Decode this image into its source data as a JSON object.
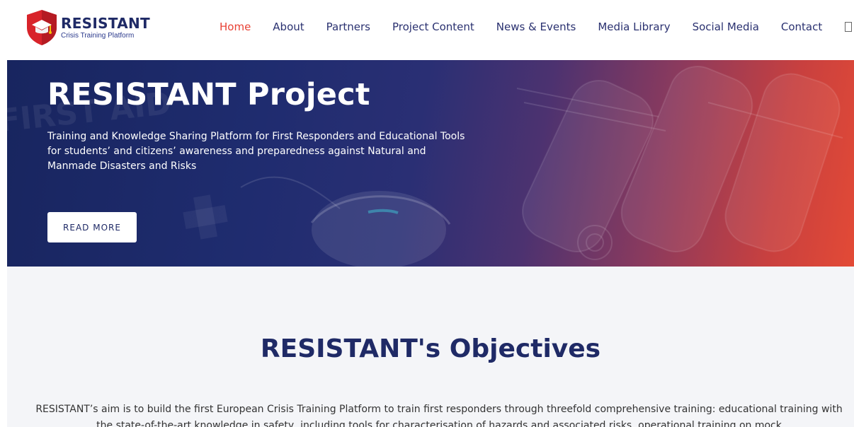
{
  "header": {
    "logo": {
      "title": "RESISTANT",
      "subtitle": "Crisis Training Platform"
    },
    "nav": [
      {
        "label": "Home",
        "active": true
      },
      {
        "label": "About"
      },
      {
        "label": "Partners"
      },
      {
        "label": "Project Content"
      },
      {
        "label": "News & Events"
      },
      {
        "label": "Media Library"
      },
      {
        "label": "Social Media"
      },
      {
        "label": "Contact"
      }
    ],
    "search_icon": "search-icon"
  },
  "hero": {
    "title": "RESISTANT Project",
    "description": "Training and Knowledge Sharing Platform for First Responders and Educational Tools for students’ and citizens’ awareness and preparedness against Natural and Manmade Disasters and Risks",
    "button_label": "READ MORE",
    "background_text": "FIRST AID"
  },
  "objectives": {
    "title": "RESISTANT's Objectives",
    "text": "RESISTANT’s aim is to build the first European Crisis Training Platform to train first responders through threefold comprehensive training: educational training with the state-of-the-art knowledge in safety, including tools for characterisation of hazards and associated risks, operational training on mock"
  },
  "colors": {
    "brand_navy": "#1f2a66",
    "accent_red": "#e84134",
    "hero_gradient_start": "#18255f",
    "hero_gradient_end": "#e34a36",
    "section_bg": "#f4f5f8"
  }
}
